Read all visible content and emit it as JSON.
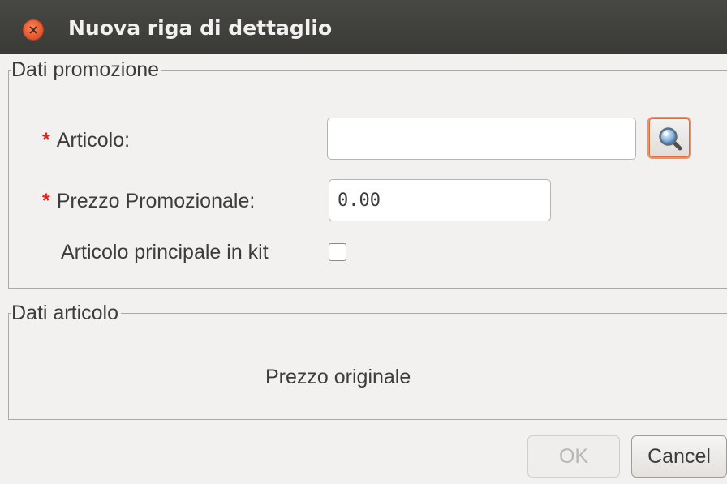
{
  "window": {
    "title": "Nuova riga di dettaglio"
  },
  "promo_group": {
    "legend": "Dati promozione",
    "required_mark": "*",
    "articolo_label": "Articolo:",
    "articolo_value": "",
    "prezzo_label": "Prezzo Promozionale:",
    "prezzo_value": "0.00",
    "kit_label": "Articolo principale in kit",
    "kit_checked": false
  },
  "articolo_group": {
    "legend": "Dati articolo",
    "prezzo_originale_label": "Prezzo originale"
  },
  "buttons": {
    "ok_label": "OK",
    "ok_enabled": false,
    "cancel_label": "Cancel"
  },
  "icons": {
    "close": "close-icon",
    "search": "magnifier-icon"
  },
  "colors": {
    "titlebar": "#3c3b37",
    "close_button": "#e95420",
    "required_star": "#d9281f",
    "focus_border": "#e9936a"
  }
}
